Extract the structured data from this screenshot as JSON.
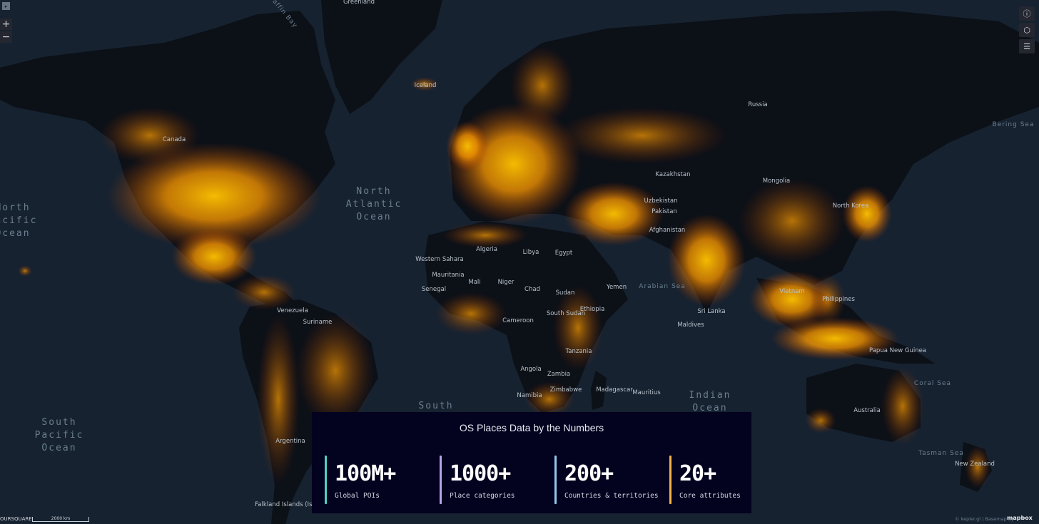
{
  "map": {
    "ocean_labels": [
      {
        "lines": [
          "North",
          "Atlantic",
          "Ocean"
        ]
      },
      {
        "lines": [
          "North",
          "Pacific",
          "Ocean"
        ]
      },
      {
        "lines": [
          "South",
          "Pacific",
          "Ocean"
        ]
      },
      {
        "lines": [
          "Indian",
          "Ocean"
        ]
      },
      {
        "lines": [
          "South"
        ]
      }
    ],
    "sea_labels": [
      "Baffin Bay",
      "Bering Sea",
      "Arabian Sea",
      "Coral Sea",
      "Tasman Sea"
    ],
    "place_labels": [
      "Greenland",
      "Iceland",
      "Russia",
      "Kazakhstan",
      "Mongolia",
      "Uzbekistan",
      "Pakistan",
      "Afghanistan",
      "Algeria",
      "Libya",
      "Egypt",
      "Mauritania",
      "Mali",
      "Niger",
      "Chad",
      "Sudan",
      "South Sudan",
      "Ethiopia",
      "Yemen",
      "Western Sahara",
      "Senegal",
      "Cameroon",
      "Angola",
      "Zambia",
      "Tanzania",
      "Zimbabwe",
      "Namibia",
      "Madagascar",
      "Mauritius",
      "Maldives",
      "Sri Lanka",
      "North Korea",
      "Vietnam",
      "Philippines",
      "Papua New Guinea",
      "Australia",
      "New Zealand",
      "Canada",
      "Venezuela",
      "Suriname",
      "Argentina",
      "Falkland Islands (Islas Malvinas)"
    ]
  },
  "controls": {
    "panel_toggle": "▸",
    "zoom_in": "+",
    "zoom_out": "−",
    "info": "ⓘ",
    "cube": "⬡",
    "legend": "☰"
  },
  "footer": {
    "attribution_left": "OURSQUARE",
    "scale": "2000 km",
    "attribution_right": "© kepler.gl | Basemap by",
    "mapbox": "mapbox"
  },
  "stats": {
    "title": "OS Places Data by the Numbers",
    "items": [
      {
        "value": "100M+",
        "label": "Global POIs",
        "accent": "#4fd1c5"
      },
      {
        "value": "1000+",
        "label": "Place categories",
        "accent": "#b7a6e6"
      },
      {
        "value": "200+",
        "label": "Countries & territories",
        "accent": "#8fc8e8"
      },
      {
        "value": "20+",
        "label": "Core attributes",
        "accent": "#f2b44a"
      }
    ]
  },
  "colors": {
    "ocean": "#162230",
    "land": "#0c1017",
    "poi_dense": "#ffc400",
    "poi_mid": "#ff9f00",
    "poi_sparse": "#c24a00"
  }
}
